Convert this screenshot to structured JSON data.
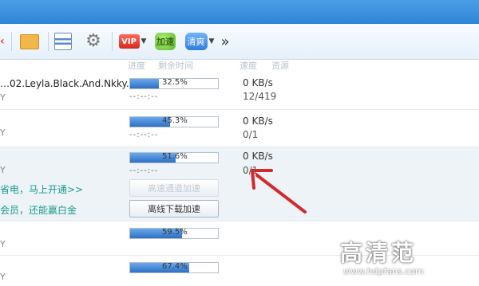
{
  "toolbar": {
    "vip_label": "VIP",
    "green_label": "加速",
    "blue_label": "清爽",
    "more": "»"
  },
  "columns": {
    "progress": "进度",
    "remaining": "剩余时间",
    "speed": "速度",
    "resource": "资源"
  },
  "rows": [
    {
      "name": "…02.Leyla.Black.And.Nkky....",
      "sub": "Y",
      "percent": "32.5%",
      "progress": 0.325,
      "eta": "--:--:--",
      "speed": "0 KB/s",
      "connections": "12/419"
    },
    {
      "sub": "Y",
      "percent": "45.3%",
      "progress": 0.453,
      "eta": "--:--:--",
      "speed": "0 KB/s",
      "connections": "0/1"
    },
    {
      "sub": "Y",
      "percent": "51.6%",
      "progress": 0.516,
      "eta": "--:--:--",
      "speed": "0 KB/s",
      "connections": "0/1",
      "promo1": "省电，马上开通>>",
      "promo2": "会员，还能赢白金",
      "btn1": "高速通道加速",
      "btn2": "离线下载加速"
    },
    {
      "sub": "Y",
      "percent": "59.5%",
      "progress": 0.595
    },
    {
      "sub": "Y",
      "percent": "67.4%",
      "progress": 0.674
    }
  ],
  "watermark": {
    "title": "高清范",
    "url": "www.hdpfans.com"
  },
  "colors": {
    "accent_blue": "#2f6fc4",
    "arrow_red": "#d42a2a",
    "promo_teal": "#1a9a8a"
  }
}
